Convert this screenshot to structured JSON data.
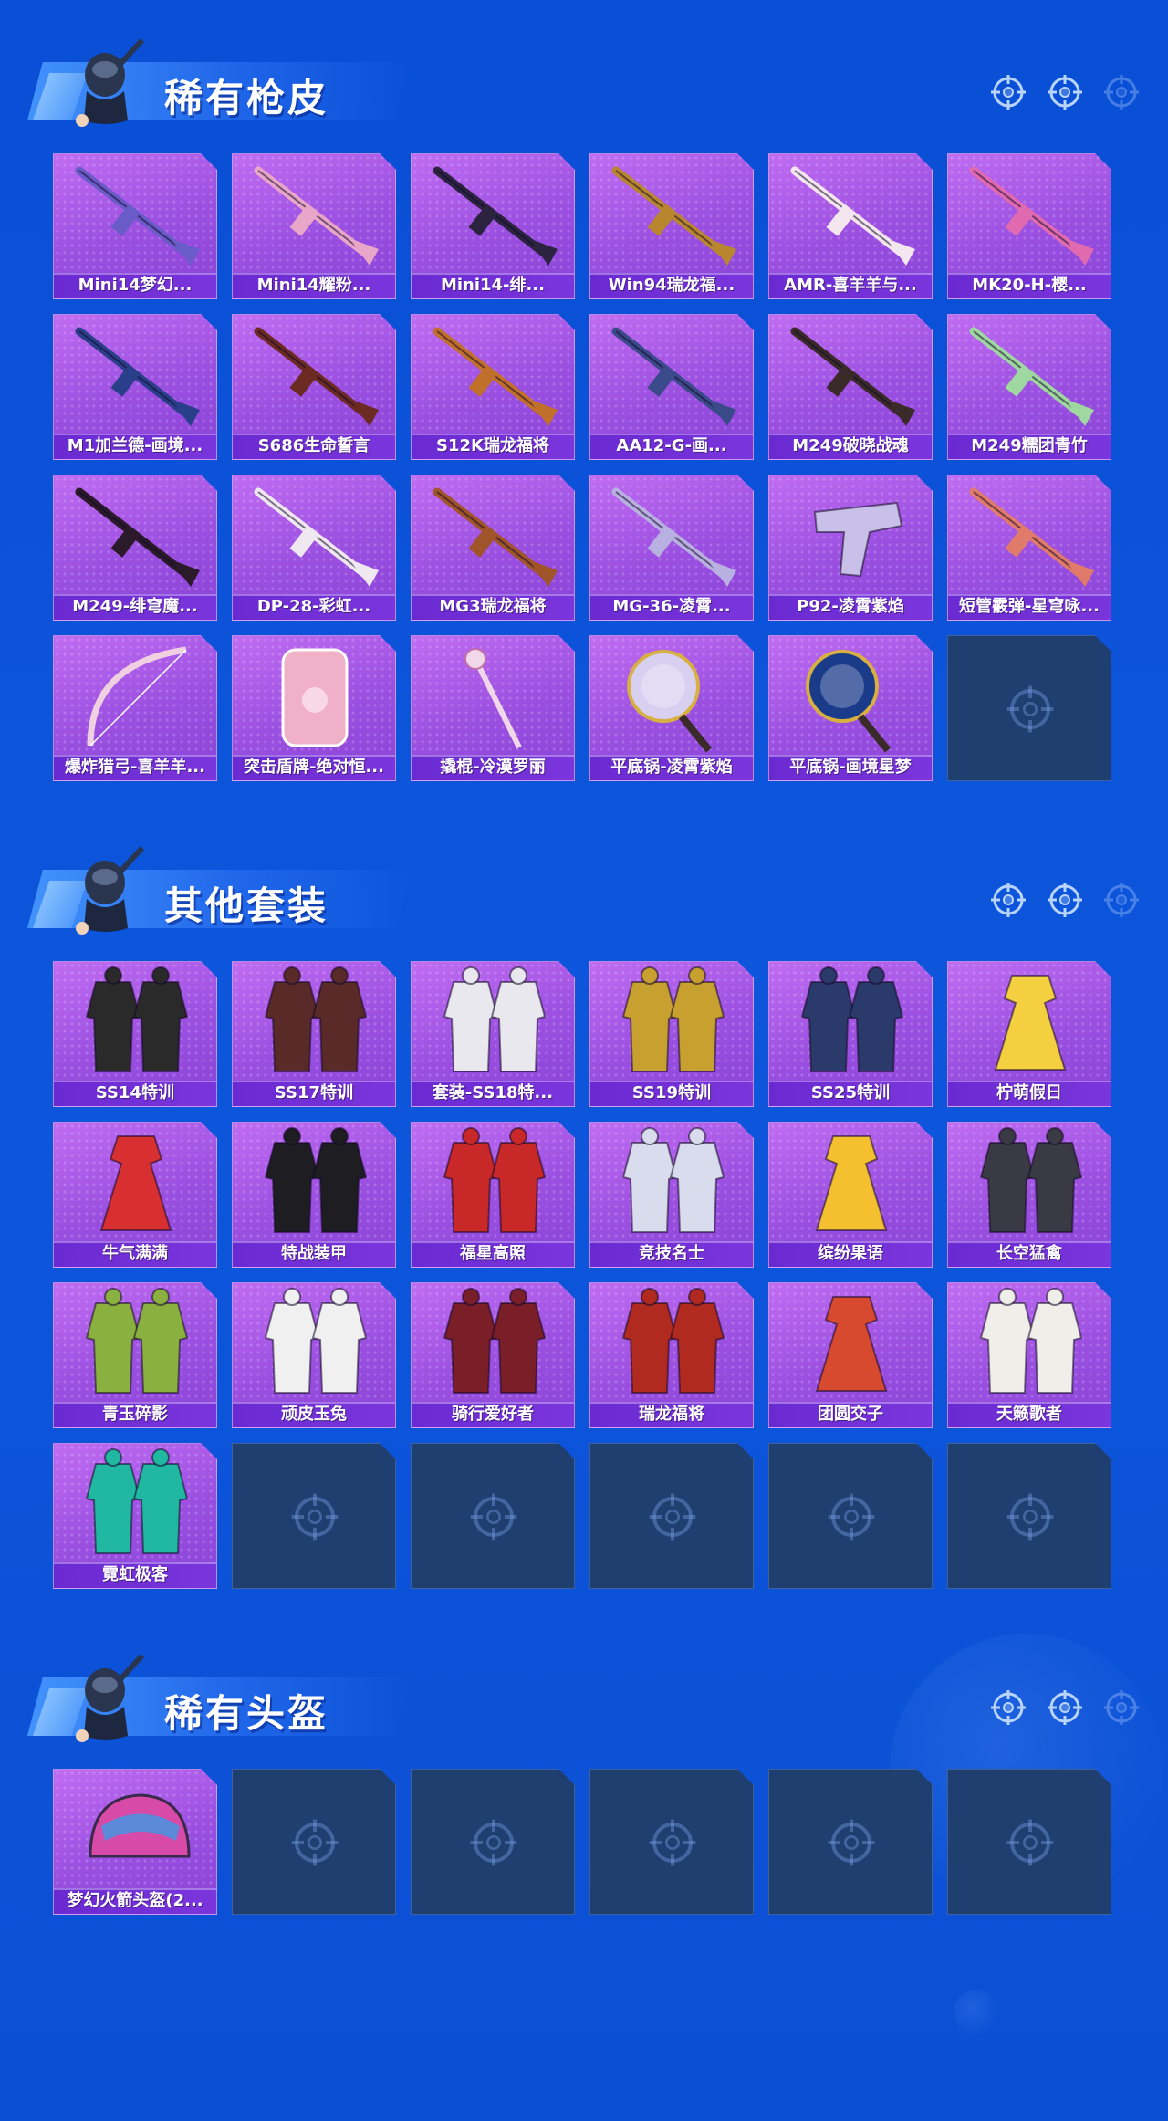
{
  "sections": [
    {
      "title": "稀有枪皮",
      "items": [
        {
          "label": "Mini14梦幻...",
          "kind": "rifle",
          "color": "#6a5cc8"
        },
        {
          "label": "Mini14耀粉...",
          "kind": "rifle",
          "color": "#e8a6c8"
        },
        {
          "label": "Mini14-绯...",
          "kind": "rifle",
          "color": "#2b2340"
        },
        {
          "label": "Win94瑞龙福...",
          "kind": "rifle",
          "color": "#b8862e"
        },
        {
          "label": "AMR-喜羊羊与...",
          "kind": "rifle",
          "color": "#f3e6ee"
        },
        {
          "label": "MK20-H-樱...",
          "kind": "rifle",
          "color": "#e06ab0"
        },
        {
          "label": "M1加兰德-画境...",
          "kind": "rifle",
          "color": "#2a3f8a"
        },
        {
          "label": "S686生命誓言",
          "kind": "rifle",
          "color": "#6b2a22"
        },
        {
          "label": "S12K瑞龙福将",
          "kind": "rifle",
          "color": "#c0702a"
        },
        {
          "label": "AA12-G-画...",
          "kind": "rifle",
          "color": "#3a4a8a"
        },
        {
          "label": "M249破晓战魂",
          "kind": "rifle",
          "color": "#3a2a2a"
        },
        {
          "label": "M249糯团青竹",
          "kind": "rifle",
          "color": "#9ed8a0"
        },
        {
          "label": "M249-绯穹魔...",
          "kind": "rifle",
          "color": "#2a1a2a"
        },
        {
          "label": "DP-28-彩虹...",
          "kind": "rifle",
          "color": "#f0e8f0"
        },
        {
          "label": "MG3瑞龙福将",
          "kind": "rifle",
          "color": "#a0542a"
        },
        {
          "label": "MG-36-凌霄...",
          "kind": "rifle",
          "color": "#b8b0e0"
        },
        {
          "label": "P92-凌霄紫焰",
          "kind": "pistol",
          "color": "#c8c0e8"
        },
        {
          "label": "短管霰弹-星穹咏...",
          "kind": "rifle",
          "color": "#e07a6a"
        },
        {
          "label": "爆炸猎弓-喜羊羊...",
          "kind": "bow",
          "color": "#f0d0e0"
        },
        {
          "label": "突击盾牌-绝对恒...",
          "kind": "shield",
          "color": "#f0b0c8"
        },
        {
          "label": "撬棍-冷漠罗丽",
          "kind": "staff",
          "color": "#f0d8e8"
        },
        {
          "label": "平底锅-凌霄紫焰",
          "kind": "pan",
          "color": "#d8d0f0"
        },
        {
          "label": "平底锅-画境星梦",
          "kind": "pan",
          "color": "#1a3a8a"
        },
        {
          "label": "",
          "kind": "empty",
          "color": ""
        }
      ]
    },
    {
      "title": "其他套装",
      "items": [
        {
          "label": "SS14特训",
          "kind": "suit",
          "color": "#2a2a2a"
        },
        {
          "label": "SS17特训",
          "kind": "suit",
          "color": "#5a2a28"
        },
        {
          "label": "套装-SS18特...",
          "kind": "suit",
          "color": "#e8e8ee"
        },
        {
          "label": "SS19特训",
          "kind": "suit",
          "color": "#c8a030"
        },
        {
          "label": "SS25特训",
          "kind": "suit",
          "color": "#2a3a6a"
        },
        {
          "label": "柠萌假日",
          "kind": "dress",
          "color": "#f4d040"
        },
        {
          "label": "牛气满满",
          "kind": "dress",
          "color": "#d83030"
        },
        {
          "label": "特战装甲",
          "kind": "suit",
          "color": "#1e1e22"
        },
        {
          "label": "福星高照",
          "kind": "suit",
          "color": "#c82828"
        },
        {
          "label": "竞技名士",
          "kind": "suit",
          "color": "#d8dcec"
        },
        {
          "label": "缤纷果语",
          "kind": "dress",
          "color": "#f4c030"
        },
        {
          "label": "长空猛禽",
          "kind": "suit",
          "color": "#3a3a44"
        },
        {
          "label": "青玉碎影",
          "kind": "suit",
          "color": "#8ab040"
        },
        {
          "label": "顽皮玉兔",
          "kind": "suit",
          "color": "#f0f0f0"
        },
        {
          "label": "骑行爱好者",
          "kind": "suit",
          "color": "#7a1e28"
        },
        {
          "label": "瑞龙福将",
          "kind": "suit",
          "color": "#b02a20"
        },
        {
          "label": "团圆交子",
          "kind": "dress",
          "color": "#d84a30"
        },
        {
          "label": "天籁歌者",
          "kind": "suit",
          "color": "#f0eee8"
        },
        {
          "label": "霓虹极客",
          "kind": "suit",
          "color": "#20b8a0"
        },
        {
          "label": "",
          "kind": "empty",
          "color": ""
        },
        {
          "label": "",
          "kind": "empty",
          "color": ""
        },
        {
          "label": "",
          "kind": "empty",
          "color": ""
        },
        {
          "label": "",
          "kind": "empty",
          "color": ""
        },
        {
          "label": "",
          "kind": "empty",
          "color": ""
        }
      ]
    },
    {
      "title": "稀有头盔",
      "items": [
        {
          "label": "梦幻火箭头盔(2...",
          "kind": "helmet",
          "color": "#d84aa8"
        },
        {
          "label": "",
          "kind": "empty",
          "color": ""
        },
        {
          "label": "",
          "kind": "empty",
          "color": ""
        },
        {
          "label": "",
          "kind": "empty",
          "color": ""
        },
        {
          "label": "",
          "kind": "empty",
          "color": ""
        },
        {
          "label": "",
          "kind": "empty",
          "color": ""
        }
      ]
    }
  ],
  "header_icons": [
    "crosshair-icon",
    "crosshair-icon",
    "crosshair-icon"
  ],
  "empty_slot_icon": "crosshair-icon",
  "colors": {
    "background": "#0d56dc",
    "card_purple": "#a356e6",
    "label_bar": "#6a2ad2",
    "empty_slot": "#1f3f70"
  }
}
